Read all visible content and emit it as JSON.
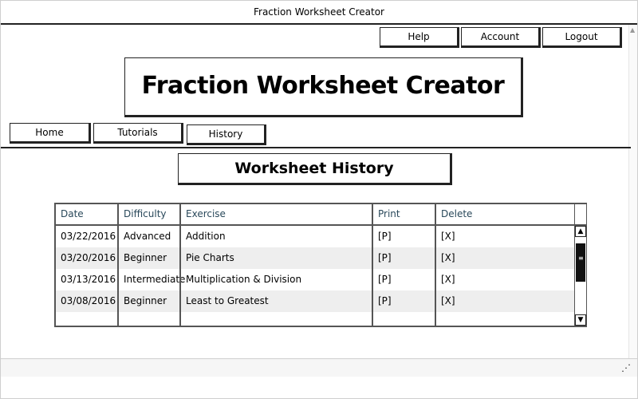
{
  "window": {
    "title": "Fraction Worksheet Creator"
  },
  "topnav": {
    "help": "Help",
    "account": "Account",
    "logout": "Logout"
  },
  "header": {
    "logo_text": "Fraction Worksheet Creator"
  },
  "tabs": {
    "home": "Home",
    "tutorials": "Tutorials",
    "history": "History"
  },
  "page": {
    "title": "Worksheet History"
  },
  "table": {
    "columns": [
      "Date",
      "Difficulty",
      "Exercise",
      "Print",
      "Delete"
    ],
    "rows": [
      [
        "03/22/2016",
        "Advanced",
        "Addition",
        "[P]",
        "[X]"
      ],
      [
        "03/20/2016",
        "Beginner",
        "Pie Charts",
        "[P]",
        "[X]"
      ],
      [
        "03/13/2016",
        "Intermediate",
        "Multiplication & Division",
        "[P]",
        "[X]"
      ],
      [
        "03/08/2016",
        "Beginner",
        "Least to Greatest",
        "[P]",
        "[X]"
      ]
    ]
  },
  "icons": {
    "scroll_up": "scroll-up-icon",
    "scroll_down": "scroll-down-icon",
    "resize_grip": "resize-grip-icon"
  },
  "colors": {
    "header_text": "#29485a",
    "row_alt": "#eeeeee",
    "border": "#222222"
  }
}
